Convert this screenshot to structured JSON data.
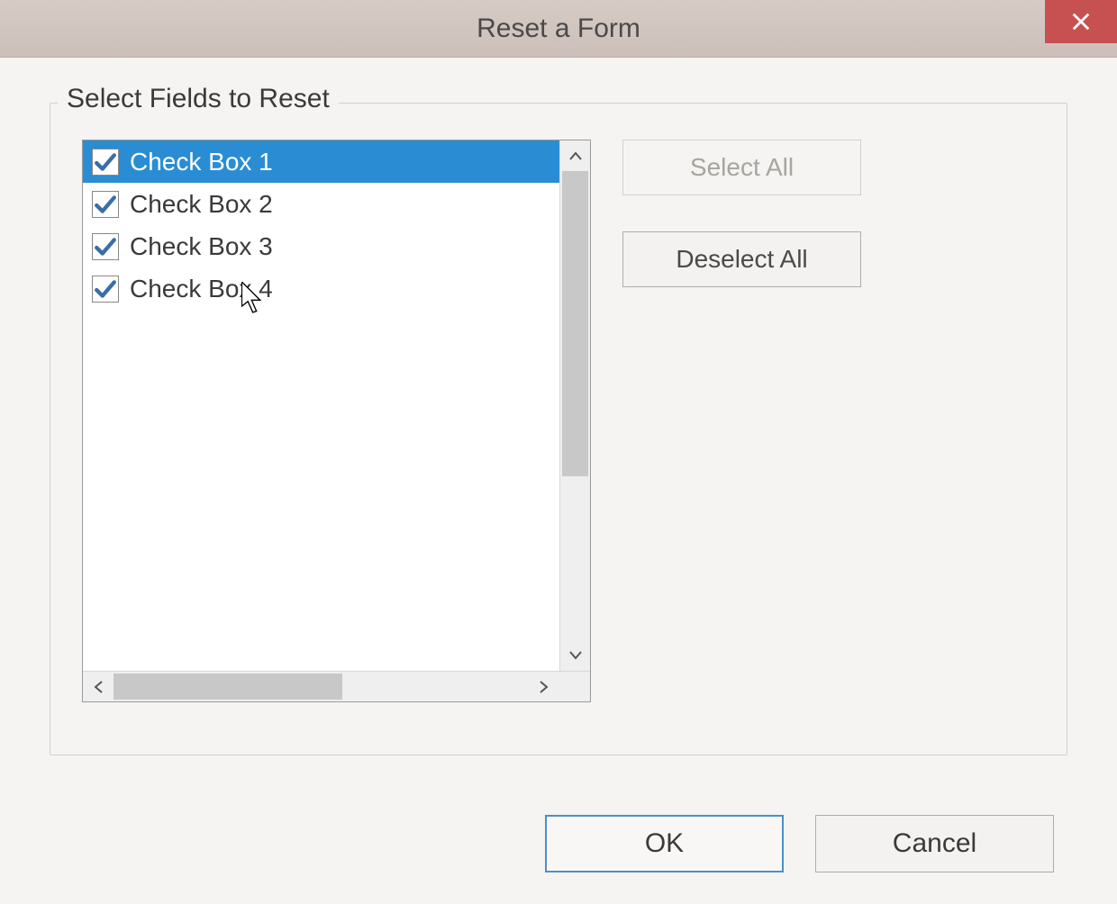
{
  "dialog": {
    "title": "Reset a Form"
  },
  "fieldset": {
    "legend": "Select Fields to Reset"
  },
  "fields": [
    {
      "label": "Check Box 1",
      "checked": true,
      "selected": true
    },
    {
      "label": "Check Box 2",
      "checked": true,
      "selected": false
    },
    {
      "label": "Check Box 3",
      "checked": true,
      "selected": false
    },
    {
      "label": "Check Box 4",
      "checked": true,
      "selected": false
    }
  ],
  "buttons": {
    "select_all": "Select All",
    "deselect_all": "Deselect All",
    "ok": "OK",
    "cancel": "Cancel"
  },
  "colors": {
    "titlebar_bg": "#d0c4be",
    "close_bg": "#c75050",
    "selection_bg": "#2a8dd4",
    "primary_border": "#4a90c8"
  }
}
